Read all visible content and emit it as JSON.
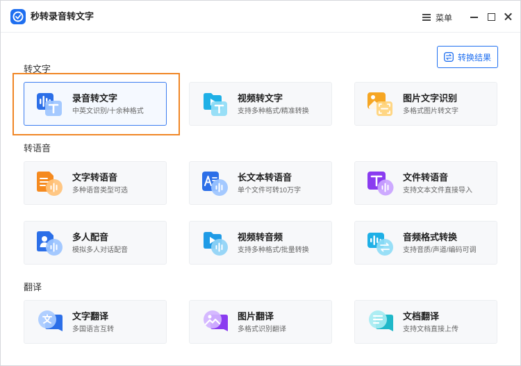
{
  "window": {
    "title": "秒转录音转文字",
    "menu_label": "菜单"
  },
  "toolbar": {
    "result_label": "转换结果"
  },
  "sections": [
    {
      "title": "转文字",
      "cards": [
        {
          "title": "录音转文字",
          "sub": "中英文识别/十余种格式",
          "icon": "audio-to-text-icon",
          "selected": true
        },
        {
          "title": "视频转文字",
          "sub": "支持多种格式/精准转换",
          "icon": "video-to-text-icon"
        },
        {
          "title": "图片文字识别",
          "sub": "多格式图片转文字",
          "icon": "image-ocr-icon"
        }
      ]
    },
    {
      "title": "转语音",
      "cards": [
        {
          "title": "文字转语音",
          "sub": "多种语音类型可选",
          "icon": "text-to-speech-icon"
        },
        {
          "title": "长文本转语音",
          "sub": "单个文件可转10万字",
          "icon": "long-text-to-speech-icon"
        },
        {
          "title": "文件转语音",
          "sub": "支持文本文件直接导入",
          "icon": "file-to-speech-icon"
        },
        {
          "title": "多人配音",
          "sub": "模拟多人对话配音",
          "icon": "multi-voice-dubbing-icon"
        },
        {
          "title": "视频转音频",
          "sub": "支持多种格式/批量转换",
          "icon": "video-to-audio-icon"
        },
        {
          "title": "音频格式转换",
          "sub": "支持音质/声道/编码可调",
          "icon": "audio-format-convert-icon"
        }
      ]
    },
    {
      "title": "翻译",
      "cards": [
        {
          "title": "文字翻译",
          "sub": "多国语言互转",
          "icon": "text-translate-icon"
        },
        {
          "title": "图片翻译",
          "sub": "多格式识别翻译",
          "icon": "image-translate-icon"
        },
        {
          "title": "文档翻译",
          "sub": "支持文档直接上传",
          "icon": "document-translate-icon"
        }
      ]
    }
  ],
  "colors": {
    "accent": "#1f6ff0",
    "highlight": "#f08524",
    "card_bg": "#f7f8fa"
  }
}
